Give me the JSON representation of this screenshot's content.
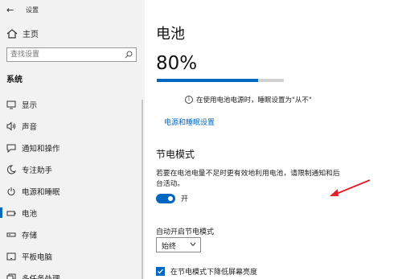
{
  "window": {
    "app_title": "设置",
    "back_icon": "back-arrow-icon"
  },
  "sidebar": {
    "home_label": "主页",
    "search": {
      "placeholder": "查找设置"
    },
    "section_title": "系统",
    "items": [
      {
        "label": "显示",
        "icon": "display-icon",
        "active": false
      },
      {
        "label": "声音",
        "icon": "speaker-icon",
        "active": false
      },
      {
        "label": "通知和操作",
        "icon": "notification-icon",
        "active": false
      },
      {
        "label": "专注助手",
        "icon": "moon-icon",
        "active": false
      },
      {
        "label": "电源和睡眠",
        "icon": "power-icon",
        "active": false
      },
      {
        "label": "电池",
        "icon": "battery-icon",
        "active": true
      },
      {
        "label": "存储",
        "icon": "storage-icon",
        "active": false
      },
      {
        "label": "平板电脑",
        "icon": "tablet-icon",
        "active": false
      },
      {
        "label": "多任务处理",
        "icon": "multitask-icon",
        "active": false
      }
    ]
  },
  "main": {
    "title": "电池",
    "battery_percent": "80%",
    "battery_level": 0.8,
    "info_text": "在使用电池电源时，睡眠设置为\"从不\"",
    "power_link": "电源和睡眠设置",
    "saver": {
      "title": "节电模式",
      "description": "若要在电池电量不足时更有效地利用电池，请限制通知和后台活动。",
      "toggle_label": "开",
      "toggle_on": true
    },
    "auto_saver": {
      "label": "自动开启节电模式",
      "dropdown_value": "始终"
    },
    "reduce_brightness": {
      "label": "在节电模式下降低屏幕亮度",
      "checked": true
    }
  },
  "colors": {
    "accent": "#0067c0",
    "annotation": "#e0202a",
    "sidebar_bg": "#f2f2f2"
  }
}
